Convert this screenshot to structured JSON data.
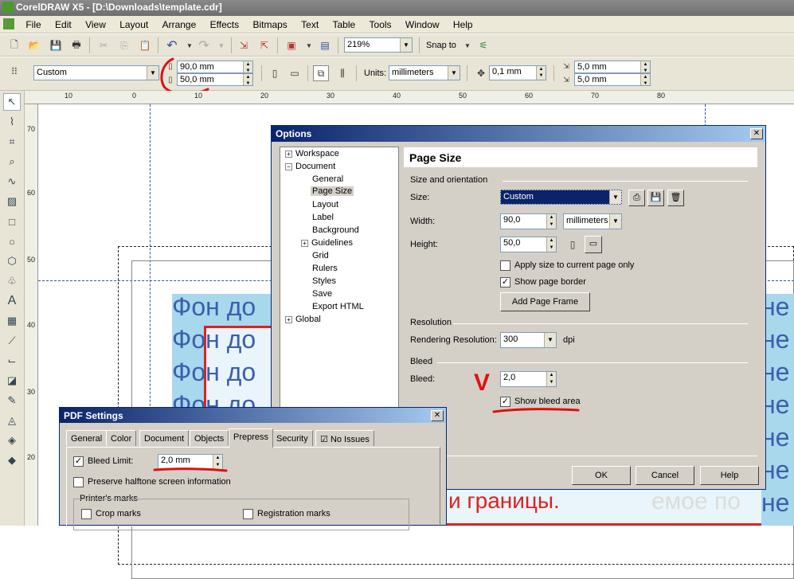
{
  "window": {
    "title": "CorelDRAW X5 - [D:\\Downloads\\template.cdr]"
  },
  "menu": [
    "File",
    "Edit",
    "View",
    "Layout",
    "Arrange",
    "Effects",
    "Bitmaps",
    "Text",
    "Table",
    "Tools",
    "Window",
    "Help"
  ],
  "toolbar": {
    "zoom": "219%",
    "snap_label": "Snap to"
  },
  "propbar": {
    "page_size": "Custom",
    "width": "90,0 mm",
    "height": "50,0 mm",
    "units_label": "Units:",
    "units": "millimeters",
    "nudge": "0,1 mm",
    "dup_x": "5,0 mm",
    "dup_y": "5,0 mm"
  },
  "rulers": {
    "h": [
      "10",
      "0",
      "10",
      "20",
      "30",
      "40",
      "50",
      "60",
      "70",
      "80"
    ],
    "v": [
      "70",
      "60",
      "50",
      "40",
      "30",
      "20"
    ]
  },
  "canvas": {
    "bg_lines": [
      "Фон до",
      "Фон до",
      "Фон до",
      "Фон до"
    ],
    "right_letters": [
      "не",
      "не",
      "не",
      "не",
      "не",
      "не",
      "не",
      "пе"
    ],
    "red_text": "и границы.",
    "faint_text": "емое по"
  },
  "options": {
    "title": "Options",
    "tree": [
      "Workspace",
      "Document",
      "General",
      "Page Size",
      "Layout",
      "Label",
      "Background",
      "Guidelines",
      "Grid",
      "Rulers",
      "Styles",
      "Save",
      "Export HTML",
      "Global"
    ],
    "header": "Page Size",
    "section_size": "Size and orientation",
    "size_label": "Size:",
    "size_value": "Custom",
    "width_label": "Width:",
    "width_value": "90,0",
    "width_units": "millimeters",
    "height_label": "Height:",
    "height_value": "50,0",
    "apply_label": "Apply size to current page only",
    "show_border_label": "Show page border",
    "add_frame": "Add Page Frame",
    "section_res": "Resolution",
    "render_label": "Rendering Resolution:",
    "render_value": "300",
    "dpi": "dpi",
    "section_bleed": "Bleed",
    "bleed_label": "Bleed:",
    "bleed_value": "2,0",
    "show_bleed_label": "Show bleed area",
    "ok": "OK",
    "cancel": "Cancel",
    "help": "Help"
  },
  "pdf": {
    "title": "PDF Settings",
    "tabs": [
      "General",
      "Color",
      "Document",
      "Objects",
      "Prepress",
      "Security",
      "No Issues"
    ],
    "bleed_limit_label": "Bleed Limit:",
    "bleed_limit_value": "2,0 mm",
    "halftone_label": "Preserve halftone screen information",
    "printers_marks": "Printer's marks",
    "crop_label": "Crop marks",
    "reg_label": "Registration marks"
  },
  "annotations": {
    "check_mark": "V"
  }
}
